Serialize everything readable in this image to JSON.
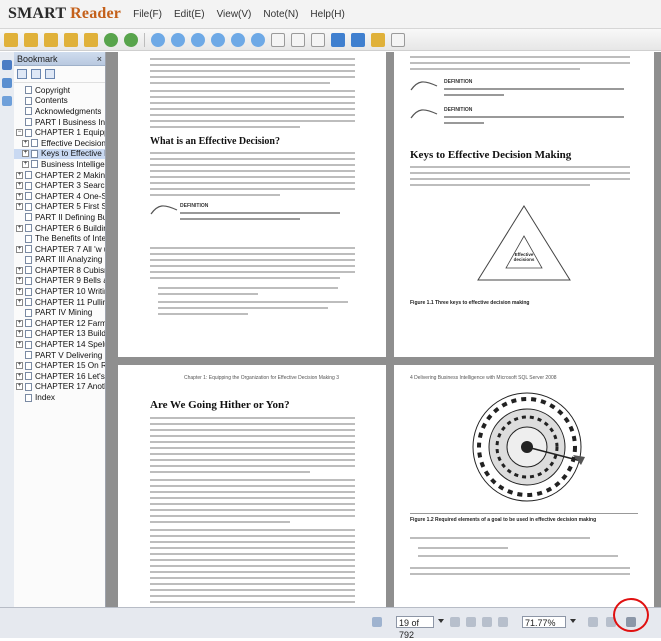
{
  "app": {
    "logo_part1": "SMART",
    "logo_part2": "Reader"
  },
  "menu": [
    "File(F)",
    "Edit(E)",
    "View(V)",
    "Note(N)",
    "Help(H)"
  ],
  "bookmarks": {
    "panel_title": "Bookmark",
    "close_glyph": "×",
    "items": [
      {
        "label": "Copyright",
        "exp": ""
      },
      {
        "label": "Contents",
        "exp": ""
      },
      {
        "label": "Acknowledgments",
        "exp": ""
      },
      {
        "label": "PART I Business Intel",
        "exp": ""
      },
      {
        "label": "CHAPTER 1 Equipping",
        "exp": "−"
      },
      {
        "label": "Effective Decision",
        "exp": "+"
      },
      {
        "label": "Keys to Effective D",
        "exp": "+"
      },
      {
        "label": "Business Intelligen",
        "exp": "+"
      },
      {
        "label": "CHAPTER 2 Making th",
        "exp": "+"
      },
      {
        "label": "CHAPTER 3 Searching",
        "exp": "+"
      },
      {
        "label": "CHAPTER 4 One-Stop",
        "exp": "+"
      },
      {
        "label": "CHAPTER 5 First Step",
        "exp": "+"
      },
      {
        "label": "PART II Defining Busi",
        "exp": ""
      },
      {
        "label": "CHAPTER 6 Building F",
        "exp": "+"
      },
      {
        "label": "The Benefits of Integ",
        "exp": ""
      },
      {
        "label": "CHAPTER 7 All 'w up",
        "exp": "+"
      },
      {
        "label": "PART III Analyzing Cu",
        "exp": ""
      },
      {
        "label": "CHAPTER 8 Cubism–",
        "exp": "+"
      },
      {
        "label": "CHAPTER 9 Bells and",
        "exp": "+"
      },
      {
        "label": "CHAPTER 10 Writing",
        "exp": "+"
      },
      {
        "label": "CHAPTER 11 Pulling t",
        "exp": "+"
      },
      {
        "label": "PART IV Mining",
        "exp": ""
      },
      {
        "label": "CHAPTER 12 Farming",
        "exp": "+"
      },
      {
        "label": "CHAPTER 13 Building",
        "exp": "+"
      },
      {
        "label": "CHAPTER 14 Spelunki",
        "exp": "+"
      },
      {
        "label": "PART V Delivering",
        "exp": ""
      },
      {
        "label": "CHAPTER 15 On Repo",
        "exp": "+"
      },
      {
        "label": "CHAPTER 16 Let's Ge",
        "exp": "+"
      },
      {
        "label": "CHAPTER 17 Another",
        "exp": "+"
      },
      {
        "label": "Index",
        "exp": ""
      }
    ]
  },
  "pages": {
    "p1_heading": "What is an Effective Decision?",
    "p1_def_label": "DEFINITION",
    "p2_def_label_1": "DEFINITION",
    "p2_def_label_2": "DEFINITION",
    "p2_heading": "Keys to Effective Decision Making",
    "p2_caption": "Figure 1.1  Three keys to effective decision making",
    "p3_header": "Chapter 1: Equipping the Organization for Effective Decision Making   3",
    "p3_heading": "Are We Going Hither or Yon?",
    "p4_header": "4   Delivering Business Intelligence with Microsoft SQL Server 2008",
    "p4_caption": "Figure 1.2  Required elements of a goal to be used in effective decision making",
    "triangle_label": "Effective decisions"
  },
  "status": {
    "page_field": "19 of 792",
    "zoom_field": "71.77%"
  },
  "colors": {
    "accent": "#c4601a",
    "selection": "#c9d9f2",
    "highlight_circle": "#e01010"
  }
}
